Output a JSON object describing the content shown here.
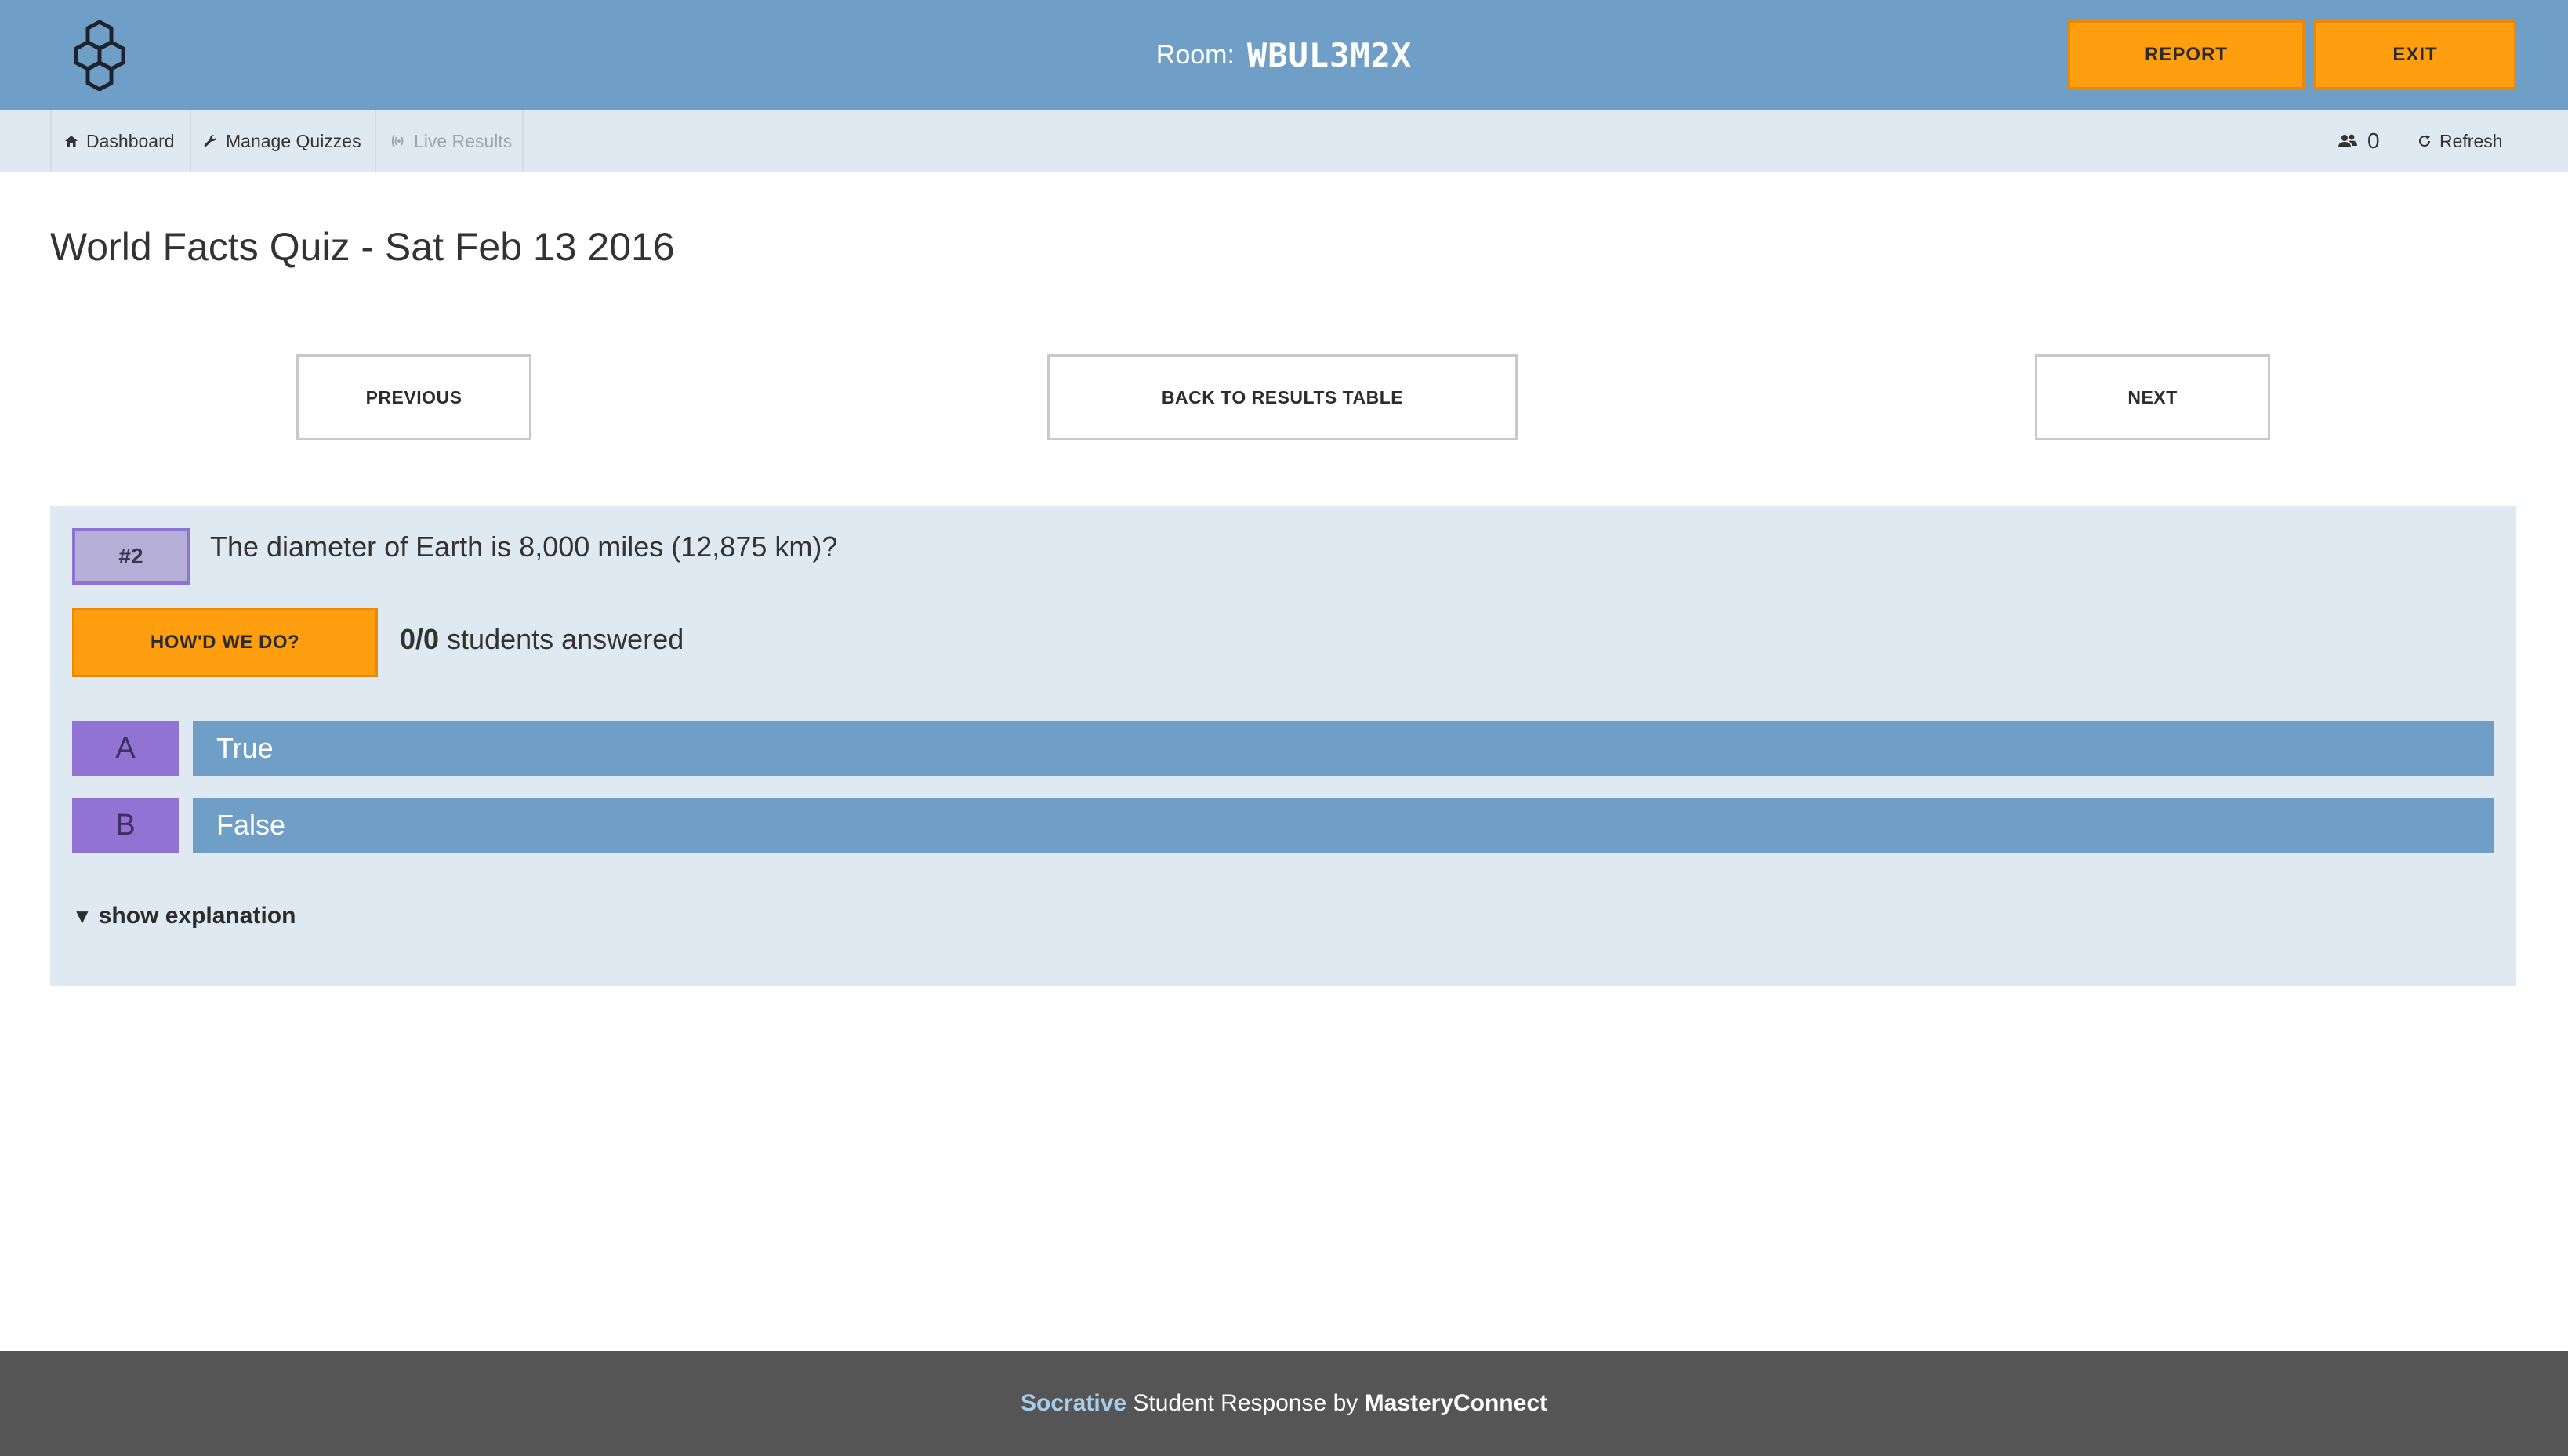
{
  "header": {
    "room_label": "Room:",
    "room_code": "WBUL3M2X",
    "report_label": "REPORT",
    "exit_label": "EXIT",
    "logo_icon": "hexagon-molecule-logo"
  },
  "nav": {
    "items": [
      {
        "label": "Dashboard",
        "icon": "home-icon"
      },
      {
        "label": "Manage Quizzes",
        "icon": "wrench-icon"
      },
      {
        "label": "Live Results",
        "icon": "broadcast-icon"
      }
    ],
    "student_count": "0",
    "refresh_label": "Refresh"
  },
  "page": {
    "title": "World Facts Quiz - Sat Feb 13 2016"
  },
  "pager": {
    "previous_label": "PREVIOUS",
    "back_label": "BACK TO RESULTS TABLE",
    "next_label": "NEXT"
  },
  "question": {
    "number": "#2",
    "text": "The diameter of Earth is 8,000 miles (12,875 km)?",
    "howd_label": "HOW'D WE DO?",
    "answered_count": "0/0",
    "answered_text": " students answered",
    "options": [
      {
        "letter": "A",
        "text": "True"
      },
      {
        "letter": "B",
        "text": "False"
      }
    ],
    "show_explanation_label": "show explanation"
  },
  "footer": {
    "brand": "Socrative",
    "middle": " Student Response by ",
    "company": "MasteryConnect"
  },
  "colors": {
    "header_bg": "#6f9fc7",
    "accent_orange": "#ff9e0f",
    "panel_bg": "#dfe9f2",
    "option_letter_bg": "#9073d3",
    "option_bar_bg": "#6f9fc7",
    "footer_bg": "#555555"
  }
}
